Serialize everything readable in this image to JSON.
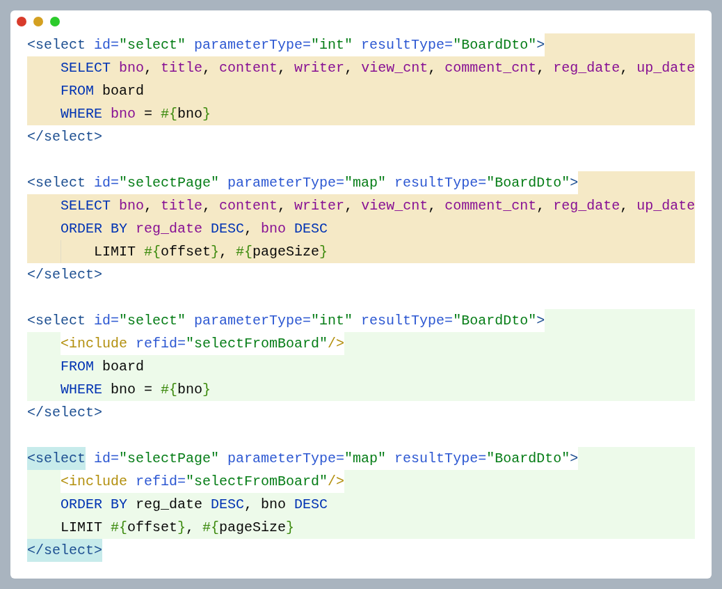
{
  "code_lines": [
    {
      "kind": "tag",
      "color": "#f5e9c6",
      "tokens": [
        {
          "t": "<select",
          "kind": "tag",
          "color": "#ffffff"
        },
        {
          "t": " id=",
          "kind": "attr",
          "color": "#ffffff"
        },
        {
          "t": "\"select\"",
          "kind": "value",
          "color": "#ffffff"
        },
        {
          "t": " parameterType=",
          "kind": "attr",
          "color": "#ffffff"
        },
        {
          "t": "\"int\"",
          "kind": "value",
          "color": "#ffffff"
        },
        {
          "t": " resultType=",
          "kind": "attr",
          "color": "#ffffff"
        },
        {
          "t": "\"BoardDto\"",
          "kind": "value",
          "color": "#ffffff"
        },
        {
          "t": ">",
          "kind": "tag",
          "color": "#ffffff"
        }
      ]
    },
    {
      "kind": "body",
      "color": "#f5e9c6",
      "tokens": [
        {
          "t": "SELECT ",
          "kind": "keyword"
        },
        {
          "t": "bno",
          "kind": "column"
        },
        {
          "t": ", ",
          "kind": "text"
        },
        {
          "t": "title",
          "kind": "column"
        },
        {
          "t": ", ",
          "kind": "text"
        },
        {
          "t": "content",
          "kind": "column"
        },
        {
          "t": ", ",
          "kind": "text"
        },
        {
          "t": "writer",
          "kind": "column"
        },
        {
          "t": ", ",
          "kind": "text"
        },
        {
          "t": "view_cnt",
          "kind": "column"
        },
        {
          "t": ", ",
          "kind": "text"
        },
        {
          "t": "comment_cnt",
          "kind": "column"
        },
        {
          "t": ", ",
          "kind": "text"
        },
        {
          "t": "reg_date",
          "kind": "column"
        },
        {
          "t": ", ",
          "kind": "text"
        },
        {
          "t": "up_date",
          "kind": "column"
        }
      ]
    },
    {
      "kind": "body",
      "color": "#f5e9c6",
      "tokens": [
        {
          "t": "FROM ",
          "kind": "keyword"
        },
        {
          "t": "board",
          "kind": "text"
        }
      ]
    },
    {
      "kind": "body",
      "color": "#f5e9c6",
      "tokens": [
        {
          "t": "WHERE ",
          "kind": "keyword"
        },
        {
          "t": "bno",
          "kind": "column"
        },
        {
          "t": " = ",
          "kind": "text"
        },
        {
          "t": "#{",
          "kind": "param"
        },
        {
          "t": "bno",
          "kind": "text"
        },
        {
          "t": "}",
          "kind": "param"
        }
      ]
    },
    {
      "kind": "tag",
      "tokens": [
        {
          "t": "</select>",
          "kind": "tag"
        }
      ]
    },
    {
      "kind": "blank"
    },
    {
      "kind": "tag",
      "color": "#f5e9c6",
      "tokens": [
        {
          "t": "<select",
          "kind": "tag",
          "color": "#ffffff"
        },
        {
          "t": " id=",
          "kind": "attr",
          "color": "#ffffff"
        },
        {
          "t": "\"selectPage\"",
          "kind": "value",
          "color": "#ffffff"
        },
        {
          "t": " parameterType=",
          "kind": "attr",
          "color": "#ffffff"
        },
        {
          "t": "\"map\"",
          "kind": "value",
          "color": "#ffffff"
        },
        {
          "t": " resultType=",
          "kind": "attr",
          "color": "#ffffff"
        },
        {
          "t": "\"BoardDto\"",
          "kind": "value",
          "color": "#ffffff"
        },
        {
          "t": ">",
          "kind": "tag",
          "color": "#ffffff"
        }
      ]
    },
    {
      "kind": "body",
      "color": "#f5e9c6",
      "tokens": [
        {
          "t": "SELECT ",
          "kind": "keyword"
        },
        {
          "t": "bno",
          "kind": "column"
        },
        {
          "t": ", ",
          "kind": "text"
        },
        {
          "t": "title",
          "kind": "column"
        },
        {
          "t": ", ",
          "kind": "text"
        },
        {
          "t": "content",
          "kind": "column"
        },
        {
          "t": ", ",
          "kind": "text"
        },
        {
          "t": "writer",
          "kind": "column"
        },
        {
          "t": ", ",
          "kind": "text"
        },
        {
          "t": "view_cnt",
          "kind": "column"
        },
        {
          "t": ", ",
          "kind": "text"
        },
        {
          "t": "comment_cnt",
          "kind": "column"
        },
        {
          "t": ", ",
          "kind": "text"
        },
        {
          "t": "reg_date",
          "kind": "column"
        },
        {
          "t": ", ",
          "kind": "text"
        },
        {
          "t": "up_date",
          "kind": "column"
        }
      ]
    },
    {
      "kind": "body",
      "color": "#f5e9c6",
      "tokens": [
        {
          "t": "ORDER BY ",
          "kind": "keyword"
        },
        {
          "t": "reg_date",
          "kind": "column"
        },
        {
          "t": " DESC",
          "kind": "keyword"
        },
        {
          "t": ", ",
          "kind": "text"
        },
        {
          "t": "bno",
          "kind": "column"
        },
        {
          "t": " DESC",
          "kind": "keyword"
        }
      ]
    },
    {
      "kind": "nested",
      "color": "#f5e9c6",
      "tokens": [
        {
          "t": "LIMIT ",
          "kind": "text"
        },
        {
          "t": "#{",
          "kind": "param"
        },
        {
          "t": "offset",
          "kind": "text"
        },
        {
          "t": "}",
          "kind": "param"
        },
        {
          "t": ", ",
          "kind": "text"
        },
        {
          "t": "#{",
          "kind": "param"
        },
        {
          "t": "pageSize",
          "kind": "text"
        },
        {
          "t": "}",
          "kind": "param"
        }
      ]
    },
    {
      "kind": "tag",
      "tokens": [
        {
          "t": "</select>",
          "kind": "tag"
        }
      ]
    },
    {
      "kind": "blank"
    },
    {
      "kind": "tag",
      "color": "#edfaea",
      "tokens": [
        {
          "t": "<select",
          "kind": "tag",
          "color": "#ffffff"
        },
        {
          "t": " id=",
          "kind": "attr",
          "color": "#ffffff"
        },
        {
          "t": "\"select\"",
          "kind": "value",
          "color": "#ffffff"
        },
        {
          "t": " parameterType=",
          "kind": "attr",
          "color": "#ffffff"
        },
        {
          "t": "\"int\"",
          "kind": "value",
          "color": "#ffffff"
        },
        {
          "t": " resultType=",
          "kind": "attr",
          "color": "#ffffff"
        },
        {
          "t": "\"BoardDto\"",
          "kind": "value",
          "color": "#ffffff"
        },
        {
          "t": ">",
          "kind": "tag",
          "color": "#ffffff"
        }
      ]
    },
    {
      "kind": "body",
      "color": "#edfaea",
      "tokens": [
        {
          "t": "<include",
          "kind": "include",
          "color": "#ffffff"
        },
        {
          "t": " refid=",
          "kind": "attr",
          "color": "#ffffff"
        },
        {
          "t": "\"selectFromBoard\"",
          "kind": "value",
          "color": "#ffffff"
        },
        {
          "t": "/>",
          "kind": "include",
          "color": "#ffffff"
        }
      ]
    },
    {
      "kind": "body",
      "color": "#edfaea",
      "tokens": [
        {
          "t": "FROM ",
          "kind": "keyword"
        },
        {
          "t": "board",
          "kind": "text"
        }
      ]
    },
    {
      "kind": "body",
      "color": "#edfaea",
      "tokens": [
        {
          "t": "WHERE ",
          "kind": "keyword"
        },
        {
          "t": "bno = ",
          "kind": "text"
        },
        {
          "t": "#{",
          "kind": "param"
        },
        {
          "t": "bno",
          "kind": "text"
        },
        {
          "t": "}",
          "kind": "param"
        }
      ]
    },
    {
      "kind": "tag",
      "tokens": [
        {
          "t": "</select>",
          "kind": "tag"
        }
      ]
    },
    {
      "kind": "blank"
    },
    {
      "kind": "tag",
      "color": "#edfaea",
      "tokens": [
        {
          "t": "<select",
          "kind": "tag",
          "color": "#c7ebeb"
        },
        {
          "t": " id=",
          "kind": "attr",
          "color": "#ffffff"
        },
        {
          "t": "\"selectPage\"",
          "kind": "value",
          "color": "#ffffff"
        },
        {
          "t": " parameterType=",
          "kind": "attr",
          "color": "#ffffff"
        },
        {
          "t": "\"map\"",
          "kind": "value",
          "color": "#ffffff"
        },
        {
          "t": " resultType=",
          "kind": "attr",
          "color": "#ffffff"
        },
        {
          "t": "\"BoardDto\"",
          "kind": "value",
          "color": "#ffffff"
        },
        {
          "t": ">",
          "kind": "tag",
          "color": "#ffffff"
        }
      ]
    },
    {
      "kind": "body",
      "color": "#edfaea",
      "tokens": [
        {
          "t": "<include",
          "kind": "include",
          "color": "#ffffff"
        },
        {
          "t": " refid=",
          "kind": "attr",
          "color": "#ffffff"
        },
        {
          "t": "\"selectFromBoard\"",
          "kind": "value",
          "color": "#ffffff"
        },
        {
          "t": "/>",
          "kind": "include",
          "color": "#ffffff"
        }
      ]
    },
    {
      "kind": "body",
      "color": "#edfaea",
      "tokens": [
        {
          "t": "ORDER BY ",
          "kind": "keyword"
        },
        {
          "t": "reg_date",
          "kind": "text"
        },
        {
          "t": " DESC",
          "kind": "keyword"
        },
        {
          "t": ", bno",
          "kind": "text"
        },
        {
          "t": " DESC",
          "kind": "keyword"
        }
      ]
    },
    {
      "kind": "body",
      "color": "#edfaea",
      "tokens": [
        {
          "t": "LIMIT ",
          "kind": "text"
        },
        {
          "t": "#{",
          "kind": "param"
        },
        {
          "t": "offset",
          "kind": "text"
        },
        {
          "t": "}",
          "kind": "param"
        },
        {
          "t": ", ",
          "kind": "text"
        },
        {
          "t": "#{",
          "kind": "param"
        },
        {
          "t": "pageSize",
          "kind": "text"
        },
        {
          "t": "}",
          "kind": "param"
        }
      ]
    },
    {
      "kind": "tag",
      "tokens": [
        {
          "t": "</select>",
          "kind": "tag",
          "color": "#c7ebeb"
        }
      ]
    }
  ]
}
